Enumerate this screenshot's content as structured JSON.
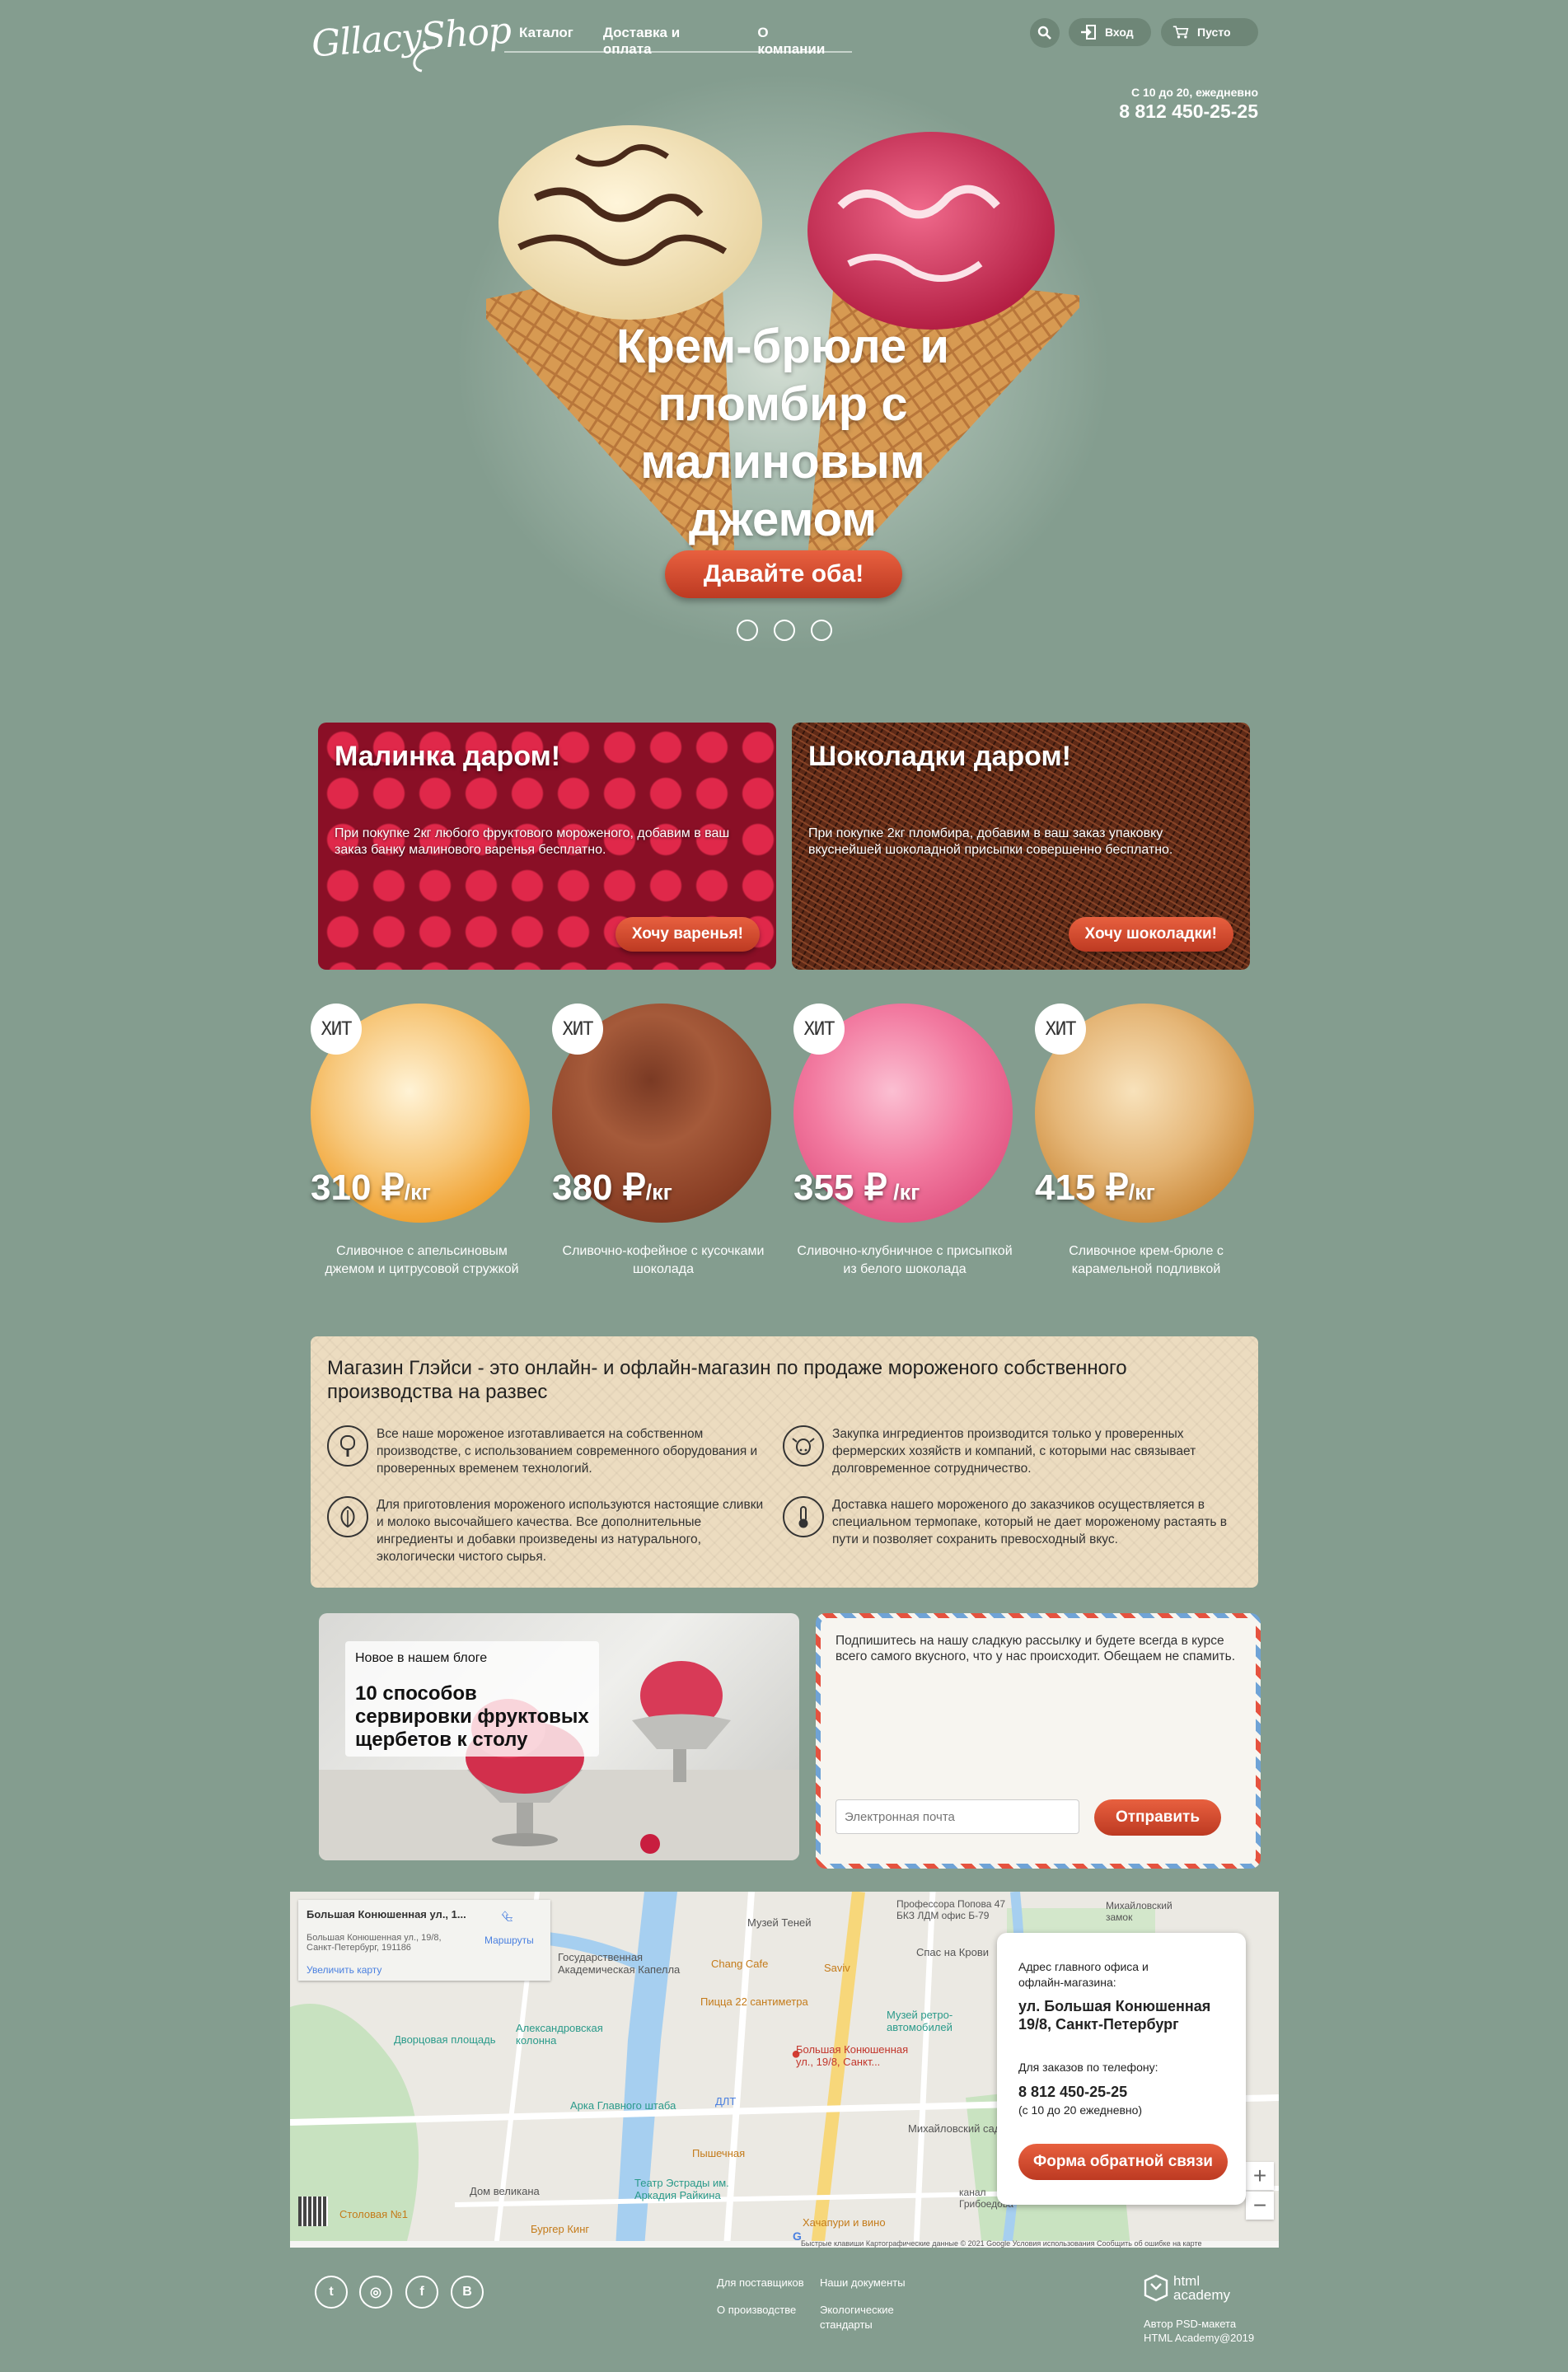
{
  "header": {
    "logo": "GllacyShop",
    "nav": [
      "Каталог",
      "Доставка и оплата",
      "О компании"
    ],
    "login_label": "Вход",
    "cart_label": "Пусто",
    "hours": "С 10 до 20, ежедневно",
    "phone": "8 812 450-25-25"
  },
  "hero": {
    "title": "Крем-брюле и пломбир с малиновым джемом",
    "button": "Давайте оба!",
    "slides": 3
  },
  "promos": [
    {
      "title": "Малинка даром!",
      "text": "При покупке 2кг любого фруктового мороженого, добавим в ваш заказ банку малинового варенья бесплатно.",
      "button": "Хочу варенья!"
    },
    {
      "title": "Шоколадки даром!",
      "text": "При покупке 2кг пломбира, добавим в ваш заказ упаковку вкуснейшей шоколадной присыпки совершенно бесплатно.",
      "button": "Хочу шоколадки!"
    }
  ],
  "products": [
    {
      "badge": "ХИТ",
      "price": "310 ₽",
      "unit": "/кг",
      "desc": "Сливочное с апельсиновым джемом и цитрусовой стружкой"
    },
    {
      "badge": "ХИТ",
      "price": "380 ₽",
      "unit": "/кг",
      "desc": "Сливочно-кофейное с кусочками шоколада"
    },
    {
      "badge": "ХИТ",
      "price": "355 ₽",
      "unit": " /кг",
      "desc": "Сливочно-клубничное с присыпкой из белого шоколада"
    },
    {
      "badge": "ХИТ",
      "price": "415 ₽",
      "unit": "/кг",
      "desc": "Сливочное крем-брюле с карамельной подливкой"
    }
  ],
  "about": {
    "title": "Магазин Глэйси - это онлайн- и офлайн-магазин по продаже мороженого собственного производства на развес",
    "features": [
      "Все наше мороженое изготавливается на собственном производстве, с использованием современного оборудования и проверенных временем технологий.",
      "Закупка ингредиентов производится только у проверенных фермерских хозяйств и компаний, с которыми нас связывает долговременное сотрудничество.",
      "Для приготовления мороженого используются настоящие сливки и молоко высочайшего качества. Все дополнительные ингредиенты и добавки произведены из натурального, экологически чистого сырья.",
      "Доставка нашего мороженого до заказчиков осуществляется в специальном термопаке, который не дает мороженому растаять в пути и позволяет сохранить превосходный вкус."
    ]
  },
  "blog": {
    "kicker": "Новое в нашем блоге",
    "title": "10 способов сервировки фруктовых щербетов к столу"
  },
  "subscribe": {
    "text": "Подпишитесь на нашу сладкую рассылку и будете всегда в курсе всего самого вкусного, что у нас происходит. Обещаем не спамить.",
    "placeholder": "Электронная почта",
    "button": "Отправить"
  },
  "map": {
    "info_title": "Большая Конюшенная ул., 1...",
    "info_address": "Большая Конюшенная ул., 19/8, Санкт-Петербург, 191186",
    "info_routes": "Маршруты",
    "info_enlarge": "Увеличить карту",
    "labels": [
      "Музей Теней",
      "Государственная Академическая Капелла",
      "Chang Cafe",
      "Saviv",
      "Пицца 22 сантиметра",
      "Александровская колонна",
      "Дворцовая площадь",
      "Музей ретро-автомобилей",
      "Большая Конюшенная ул., 19/8, Санкт...",
      "Арка Главного штаба",
      "ДЛТ",
      "Пышечная",
      "Михайловский сад",
      "Дом великана",
      "Театр Эстрады им. Аркадия Райкина",
      "Столовая №1",
      "Бургер Кинг",
      "Хачапури и вино",
      "Профессора Попова 47 БКЗ ЛДМ офис Б-79",
      "Спас на Крови",
      "Михайловский замок",
      "канал Грибоедова"
    ],
    "attribution": "Быстрые клавиши   Картографические данные © 2021 Google   Условия использования   Сообщить об ошибке на карте",
    "contact": {
      "addr_label": "Адрес главного офиса и офлайн-магазина:",
      "addr": "ул. Большая Конюшенная 19/8, Санкт-Петербург",
      "phone_label": "Для заказов по телефону:",
      "phone": "8 812 450-25-25",
      "phone_note": "(с 10 до 20 ежедневно)",
      "button": "Форма обратной связи"
    }
  },
  "footer": {
    "links": [
      "Для поставщиков",
      "Наши документы",
      "О производстве",
      "Экологические стандарты"
    ],
    "social": [
      "twitter",
      "instagram",
      "facebook",
      "vkontakte"
    ],
    "academy_logo": "html academy",
    "author": "Автор PSD-макета HTML Academy@2019"
  },
  "colors": {
    "background": "#849d8f",
    "accent": "#d94b2e",
    "about_bg": "#ecdcc0"
  }
}
